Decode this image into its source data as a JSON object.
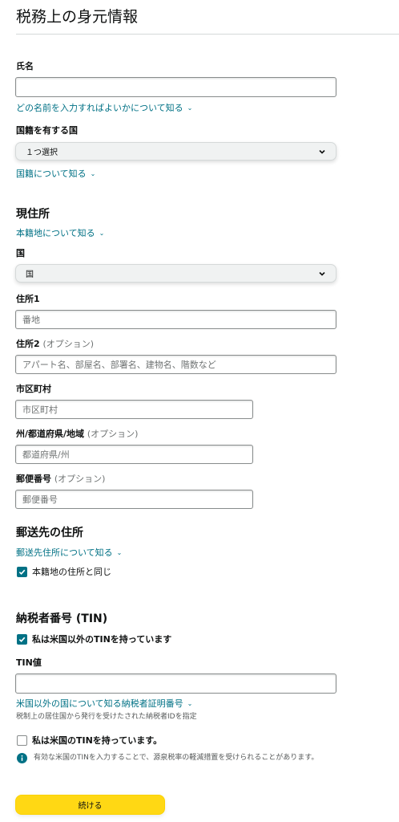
{
  "page_title": "税務上の身元情報",
  "name_section": {
    "label": "氏名",
    "value": "",
    "help_link": "どの名前を入力すればよいかについて知る"
  },
  "citizenship": {
    "label": "国籍を有する国",
    "selected": "１つ選択",
    "help_link": "国籍について知る"
  },
  "current_address": {
    "heading": "現住所",
    "help_link": "本籍地について知る",
    "country_label": "国",
    "country_selected": "国",
    "address1_label": "住所1",
    "address1_placeholder": "番地",
    "address2_label": "住所2",
    "address2_optional": "(オプション)",
    "address2_placeholder": "アパート名、部屋名、部署名、建物名、階数など",
    "city_label": "市区町村",
    "city_placeholder": "市区町村",
    "state_label": "州/都道府県/地域",
    "state_optional": "(オプション)",
    "state_placeholder": "都道府県/州",
    "postal_label": "郵便番号",
    "postal_optional": "(オプション)",
    "postal_placeholder": "郵便番号"
  },
  "mailing_address": {
    "heading": "郵送先の住所",
    "help_link": "郵送先住所について知る",
    "same_checkbox_label": "本籍地の住所と同じ",
    "same_checked": true
  },
  "tin": {
    "heading": "納税者番号 (TIN)",
    "non_us_checkbox_label": "私は米国以外のTINを持っています",
    "non_us_checked": true,
    "tin_value_label": "TIN値",
    "tin_value": "",
    "help_link": "米国以外の国について知る納税者証明番号",
    "note": "税制上の居住国から発行を受けたされた納税者IDを指定",
    "us_checkbox_label": "私は米国のTINを持っています。",
    "us_checked": false,
    "info_text": "有効な米国のTINを入力することで、源泉税率の軽減措置を受けられることがあります。"
  },
  "continue_button": "続ける",
  "colors": {
    "link": "#007185",
    "checkbox_checked": "#007185",
    "button_yellow": "#ffd814",
    "select_bg": "#f0f2f2"
  }
}
